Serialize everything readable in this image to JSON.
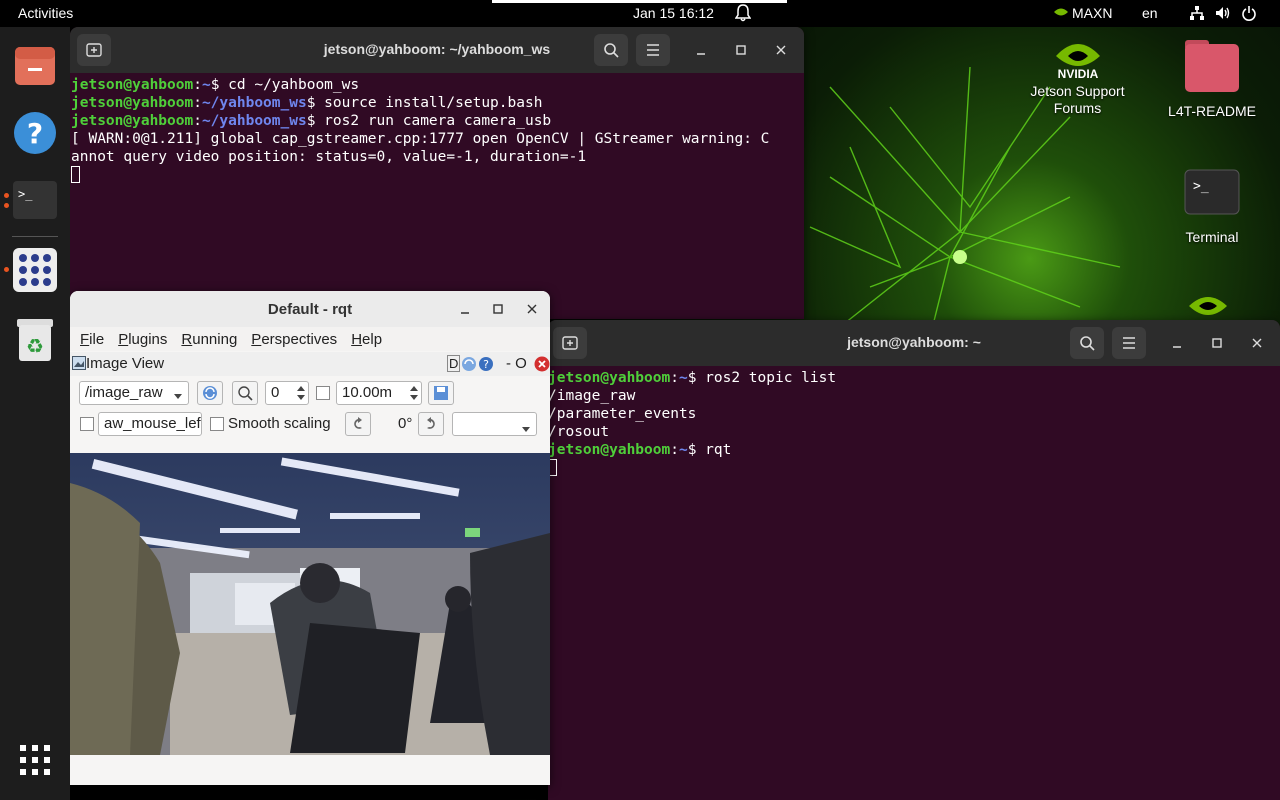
{
  "topbar": {
    "activities": "Activities",
    "clock": "Jan 15  16:12",
    "power_mode": "MAXN",
    "language": "en"
  },
  "desktop": {
    "icons": [
      {
        "label": "Jetson Support\nForums",
        "icon": "nvidia-logo-icon"
      },
      {
        "label": "L4T-README",
        "icon": "folder-icon"
      },
      {
        "label": "Terminal",
        "icon": "terminal-icon"
      }
    ]
  },
  "terminal1": {
    "title": "jetson@yahboom: ~/yahboom_ws",
    "lines": [
      {
        "user": "jetson@yahboom",
        "path": "~",
        "cmd": "$ cd ~/yahboom_ws"
      },
      {
        "user": "jetson@yahboom",
        "path": "~/yahboom_ws",
        "cmd": "$ source install/setup.bash"
      },
      {
        "user": "jetson@yahboom",
        "path": "~/yahboom_ws",
        "cmd": "$ ros2 run camera camera_usb"
      }
    ],
    "output": [
      "[ WARN:0@1.211] global cap_gstreamer.cpp:1777 open OpenCV | GStreamer warning: C",
      "annot query video position: status=0, value=-1, duration=-1"
    ]
  },
  "terminal2": {
    "title": "jetson@yahboom: ~",
    "line1": {
      "user": "jetson@yahboom",
      "path": "~",
      "cmd": "$ ros2 topic list"
    },
    "output": [
      "/image_raw",
      "/parameter_events",
      "/rosout"
    ],
    "line2": {
      "user": "jetson@yahboom",
      "path": "~",
      "cmd": "$ rqt"
    }
  },
  "rqt": {
    "title": "Default - rqt",
    "menu": [
      "File",
      "Plugins",
      "Running",
      "Perspectives",
      "Help"
    ],
    "plugin_title": "Image View",
    "plugin_ctrl": "D",
    "plugin_dash": "- O",
    "topic": "/image_raw",
    "zoom": "0",
    "max_value": "10.00m",
    "mouse_topic": "aw_mouse_left",
    "smooth_label": "Smooth scaling",
    "rotation": "0°"
  },
  "colors": {
    "terminal_bg": "#300a24",
    "user_green": "#4fcf3a",
    "path_blue": "#6f86ee",
    "ubuntu_orange": "#e95420"
  }
}
